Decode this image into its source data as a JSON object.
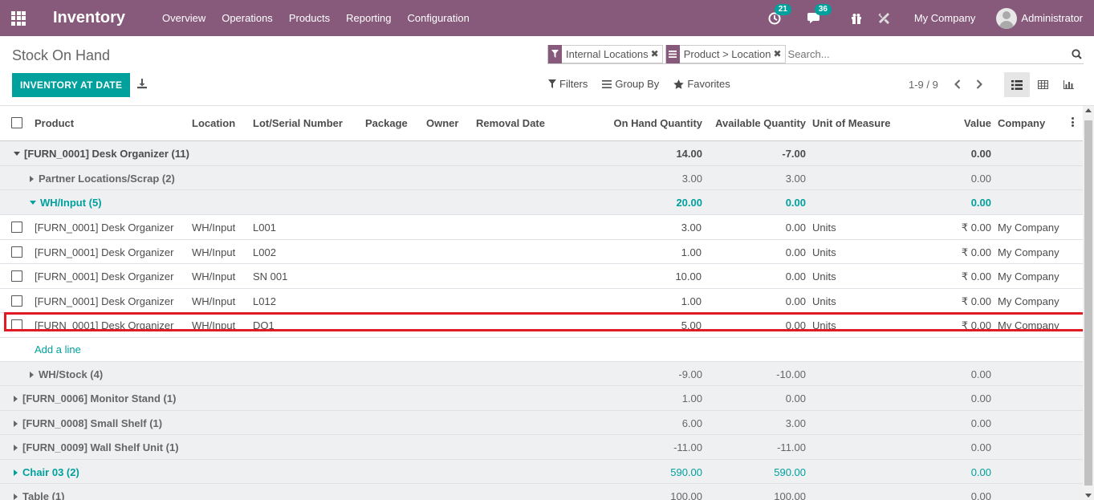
{
  "navbar": {
    "app_title": "Inventory",
    "menu": [
      "Overview",
      "Operations",
      "Products",
      "Reporting",
      "Configuration"
    ],
    "activity_count": "21",
    "messages_count": "36",
    "company": "My Company",
    "user": "Administrator"
  },
  "control": {
    "page_title": "Stock On Hand",
    "facets": [
      "Internal Locations",
      "Product > Location"
    ],
    "search_placeholder": "Search...",
    "primary_button": "INVENTORY AT DATE",
    "filters": "Filters",
    "group_by": "Group By",
    "favorites": "Favorites",
    "pager": "1-9 / 9"
  },
  "table": {
    "columns": [
      "Product",
      "Location",
      "Lot/Serial Number",
      "Package",
      "Owner",
      "Removal Date",
      "On Hand Quantity",
      "Available Quantity",
      "Unit of Measure",
      "Value",
      "Company"
    ],
    "groups_top": [
      {
        "label": "[FURN_0001] Desk Organizer (11)",
        "on_hand": "14.00",
        "available": "-7.00",
        "value": "0.00"
      },
      {
        "label": "Partner Locations/Scrap (2)",
        "on_hand": "3.00",
        "available": "3.00",
        "value": "0.00"
      },
      {
        "label": "WH/Input (5)",
        "on_hand": "20.00",
        "available": "0.00",
        "value": "0.00"
      }
    ],
    "rows": [
      {
        "product": "[FURN_0001] Desk Organizer",
        "location": "WH/Input",
        "lot": "L001",
        "on_hand": "3.00",
        "available": "0.00",
        "uom": "Units",
        "value": "₹ 0.00",
        "company": "My Company"
      },
      {
        "product": "[FURN_0001] Desk Organizer",
        "location": "WH/Input",
        "lot": "L002",
        "on_hand": "1.00",
        "available": "0.00",
        "uom": "Units",
        "value": "₹ 0.00",
        "company": "My Company"
      },
      {
        "product": "[FURN_0001] Desk Organizer",
        "location": "WH/Input",
        "lot": "SN 001",
        "on_hand": "10.00",
        "available": "0.00",
        "uom": "Units",
        "value": "₹ 0.00",
        "company": "My Company"
      },
      {
        "product": "[FURN_0001] Desk Organizer",
        "location": "WH/Input",
        "lot": "L012",
        "on_hand": "1.00",
        "available": "0.00",
        "uom": "Units",
        "value": "₹ 0.00",
        "company": "My Company"
      },
      {
        "product": "[FURN_0001] Desk Organizer",
        "location": "WH/Input",
        "lot": "DO1",
        "on_hand": "5.00",
        "available": "0.00",
        "uom": "Units",
        "value": "₹ 0.00",
        "company": "My Company"
      }
    ],
    "add_line": "Add a line",
    "groups_bottom": [
      {
        "label": "WH/Stock (4)",
        "on_hand": "-9.00",
        "available": "-10.00",
        "value": "0.00"
      },
      {
        "label": "[FURN_0006] Monitor Stand (1)",
        "on_hand": "1.00",
        "available": "0.00",
        "value": "0.00"
      },
      {
        "label": "[FURN_0008] Small Shelf (1)",
        "on_hand": "6.00",
        "available": "3.00",
        "value": "0.00"
      },
      {
        "label": "[FURN_0009] Wall Shelf Unit (1)",
        "on_hand": "-11.00",
        "available": "-11.00",
        "value": "0.00"
      },
      {
        "label": "Chair 03 (2)",
        "on_hand": "590.00",
        "available": "590.00",
        "value": "0.00"
      },
      {
        "label": "Table (1)",
        "on_hand": "100.00",
        "available": "100.00",
        "value": "0.00"
      }
    ]
  },
  "colors": {
    "brand": "#875a7b",
    "accent": "#00a09d",
    "highlight": "#e01b24"
  },
  "icons": [
    "apps-icon",
    "activity-icon",
    "chat-icon",
    "gift-icon",
    "debug-icon",
    "filter-icon",
    "group-icon",
    "star-icon",
    "download-icon",
    "search-icon",
    "list-view-icon",
    "pivot-view-icon",
    "graph-view-icon",
    "chevron-left-icon",
    "chevron-right-icon"
  ]
}
